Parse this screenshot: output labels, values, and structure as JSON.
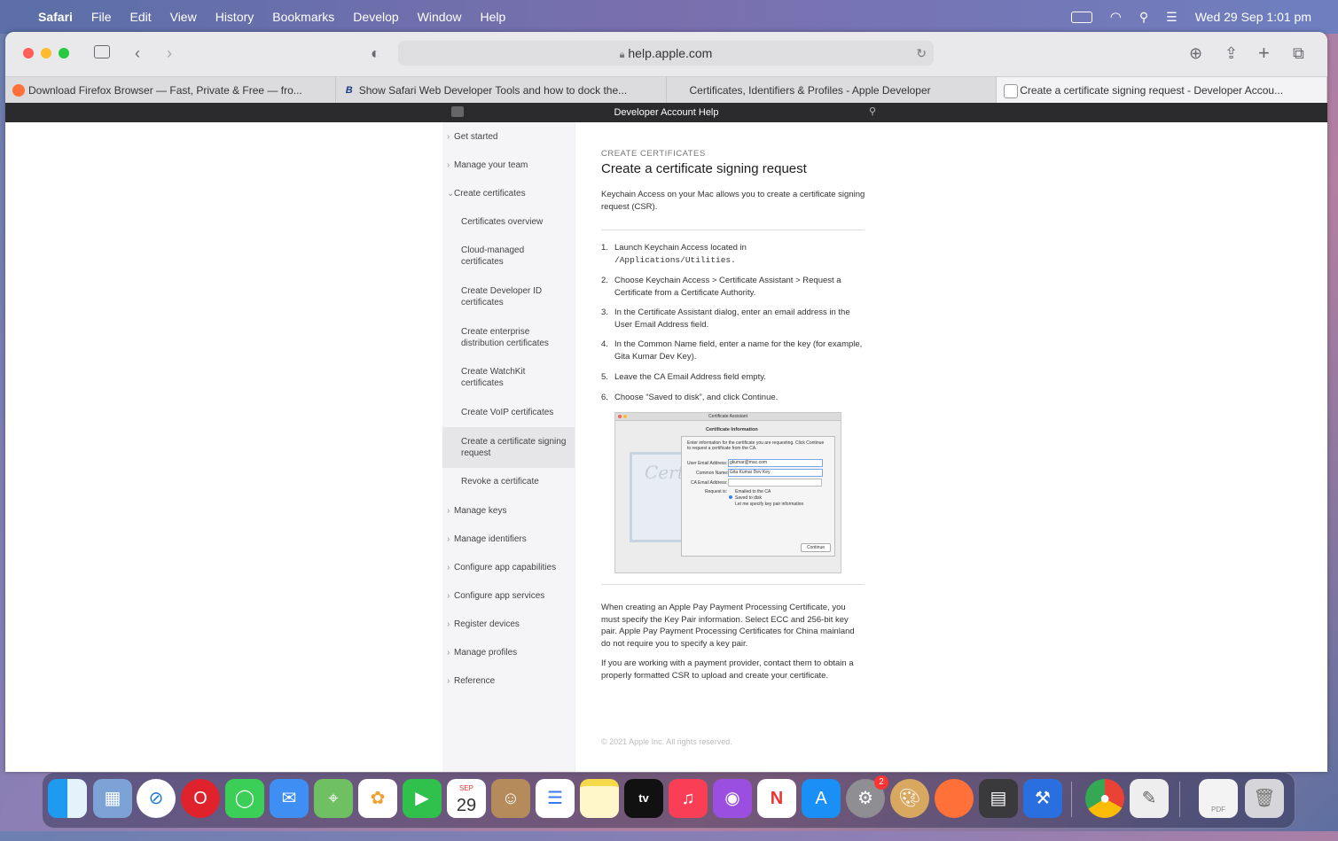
{
  "menubar": {
    "apple": "",
    "items": [
      "Safari",
      "File",
      "Edit",
      "View",
      "History",
      "Bookmarks",
      "Develop",
      "Window",
      "Help"
    ],
    "clock": "Wed 29 Sep  1:01 pm"
  },
  "toolbar": {
    "url": "help.apple.com"
  },
  "tabs": [
    {
      "label": "Download Firefox Browser — Fast, Private & Free — fro...",
      "icon": "firefox-icon"
    },
    {
      "label": "Show Safari Web Developer Tools and how to dock the...",
      "icon": "b-icon"
    },
    {
      "label": "Certificates, Identifiers & Profiles - Apple Developer",
      "icon": "apple-icon"
    },
    {
      "label": "Create a certificate signing request - Developer Accou...",
      "icon": "page-icon"
    }
  ],
  "page_header": {
    "title": "Developer Account Help"
  },
  "sidebar": {
    "get_started": "Get started",
    "manage_team": "Manage your team",
    "create_certs": "Create certificates",
    "sub": [
      "Certificates overview",
      "Cloud-managed certificates",
      "Create Developer ID certificates",
      "Create enterprise distribution certificates",
      "Create WatchKit certificates",
      "Create VoIP certificates",
      "Create a certificate signing request",
      "Revoke a certificate"
    ],
    "rest": [
      "Manage keys",
      "Manage identifiers",
      "Configure app capabilities",
      "Configure app services",
      "Register devices",
      "Manage profiles",
      "Reference"
    ]
  },
  "content": {
    "eyebrow": "CREATE CERTIFICATES",
    "title": "Create a certificate signing request",
    "intro": "Keychain Access on your Mac allows you to create a certificate signing request (CSR).",
    "steps": [
      {
        "n": "1.",
        "text": "Launch Keychain Access located in",
        "mono": "/Applications/Utilities."
      },
      {
        "n": "2.",
        "text": "Choose Keychain Access > Certificate Assistant > Request a Certificate from a Certificate Authority."
      },
      {
        "n": "3.",
        "text": "In the Certificate Assistant dialog, enter an email address in the User Email Address field."
      },
      {
        "n": "4.",
        "text": "In the Common Name field, enter a name for the key (for example, Gita Kumar Dev Key)."
      },
      {
        "n": "5.",
        "text": "Leave the CA Email Address field empty."
      },
      {
        "n": "6.",
        "text": "Choose “Saved to disk”, and click Continue."
      }
    ],
    "dialog": {
      "window_title": "Certificate Assistant",
      "heading": "Certificate Information",
      "desc": "Enter information for the certificate you are requesting. Click Continue to request a certificate from the CA.",
      "user_email_label": "User Email Address:",
      "user_email_value": "gkumar@mac.com",
      "common_name_label": "Common Name:",
      "common_name_value": "Gita Kumar Dev Key",
      "ca_email_label": "CA Email Address:",
      "request_label": "Request is:",
      "opt1": "Emailed to the CA",
      "opt2": "Saved to disk",
      "opt3": "Let me specify key pair information",
      "continue": "Continue"
    },
    "note1": "When creating an Apple Pay Payment Processing Certificate, you must specify the Key Pair information. Select ECC and 256-bit key pair. Apple Pay Payment Processing Certificates for China mainland do not require you to specify a key pair.",
    "note2": "If you are working with a payment provider, contact them to obtain a properly formatted CSR to upload and create your certificate.",
    "footer": "© 2021 Apple Inc. All rights reserved."
  },
  "dock": {
    "calendar_month": "SEP",
    "calendar_day": "29",
    "tv_label": "tv",
    "badge": "2",
    "pdf_label": "PDF"
  }
}
